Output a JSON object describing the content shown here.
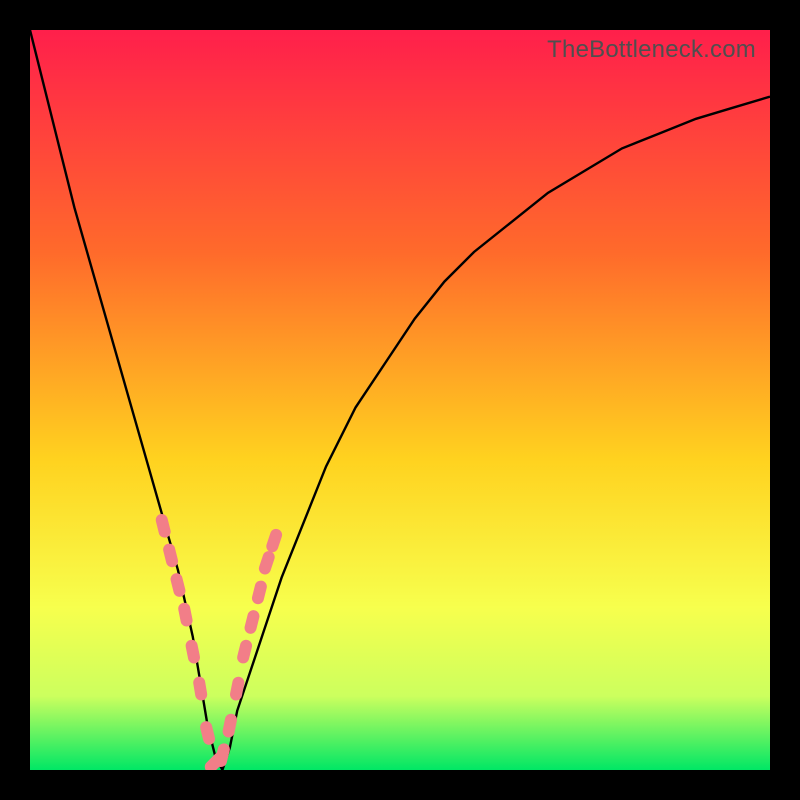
{
  "watermark": "TheBottleneck.com",
  "colors": {
    "gradient_top": "#ff1f4b",
    "gradient_mid1": "#ff6a2b",
    "gradient_mid2": "#ffd21f",
    "gradient_mid3": "#f7ff4d",
    "gradient_mid4": "#ccff5e",
    "gradient_bottom": "#00e765",
    "curve": "#000000",
    "marker": "#f27e88",
    "background": "#000000"
  },
  "chart_data": {
    "type": "line",
    "title": "",
    "xlabel": "",
    "ylabel": "",
    "xlim": [
      0,
      100
    ],
    "ylim": [
      0,
      100
    ],
    "x": [
      0,
      2,
      4,
      6,
      8,
      10,
      12,
      14,
      16,
      18,
      20,
      22,
      23,
      24,
      25,
      26,
      27,
      28,
      30,
      32,
      34,
      36,
      38,
      40,
      44,
      48,
      52,
      56,
      60,
      65,
      70,
      75,
      80,
      85,
      90,
      95,
      100
    ],
    "values": [
      100,
      92,
      84,
      76,
      69,
      62,
      55,
      48,
      41,
      34,
      27,
      18,
      12,
      6,
      2,
      0,
      3,
      8,
      14,
      20,
      26,
      31,
      36,
      41,
      49,
      55,
      61,
      66,
      70,
      74,
      78,
      81,
      84,
      86,
      88,
      89.5,
      91
    ],
    "series": [
      {
        "name": "bottleneck-curve",
        "x_ref": "x",
        "y_ref": "values"
      }
    ],
    "markers": {
      "name": "sample-points",
      "x": [
        18,
        19,
        20,
        21,
        22,
        23,
        24,
        25,
        26,
        27,
        28,
        29,
        30,
        31,
        32,
        33
      ],
      "y": [
        33,
        29,
        25,
        21,
        16,
        11,
        5,
        1,
        2,
        6,
        11,
        16,
        20,
        24,
        28,
        31
      ]
    }
  }
}
